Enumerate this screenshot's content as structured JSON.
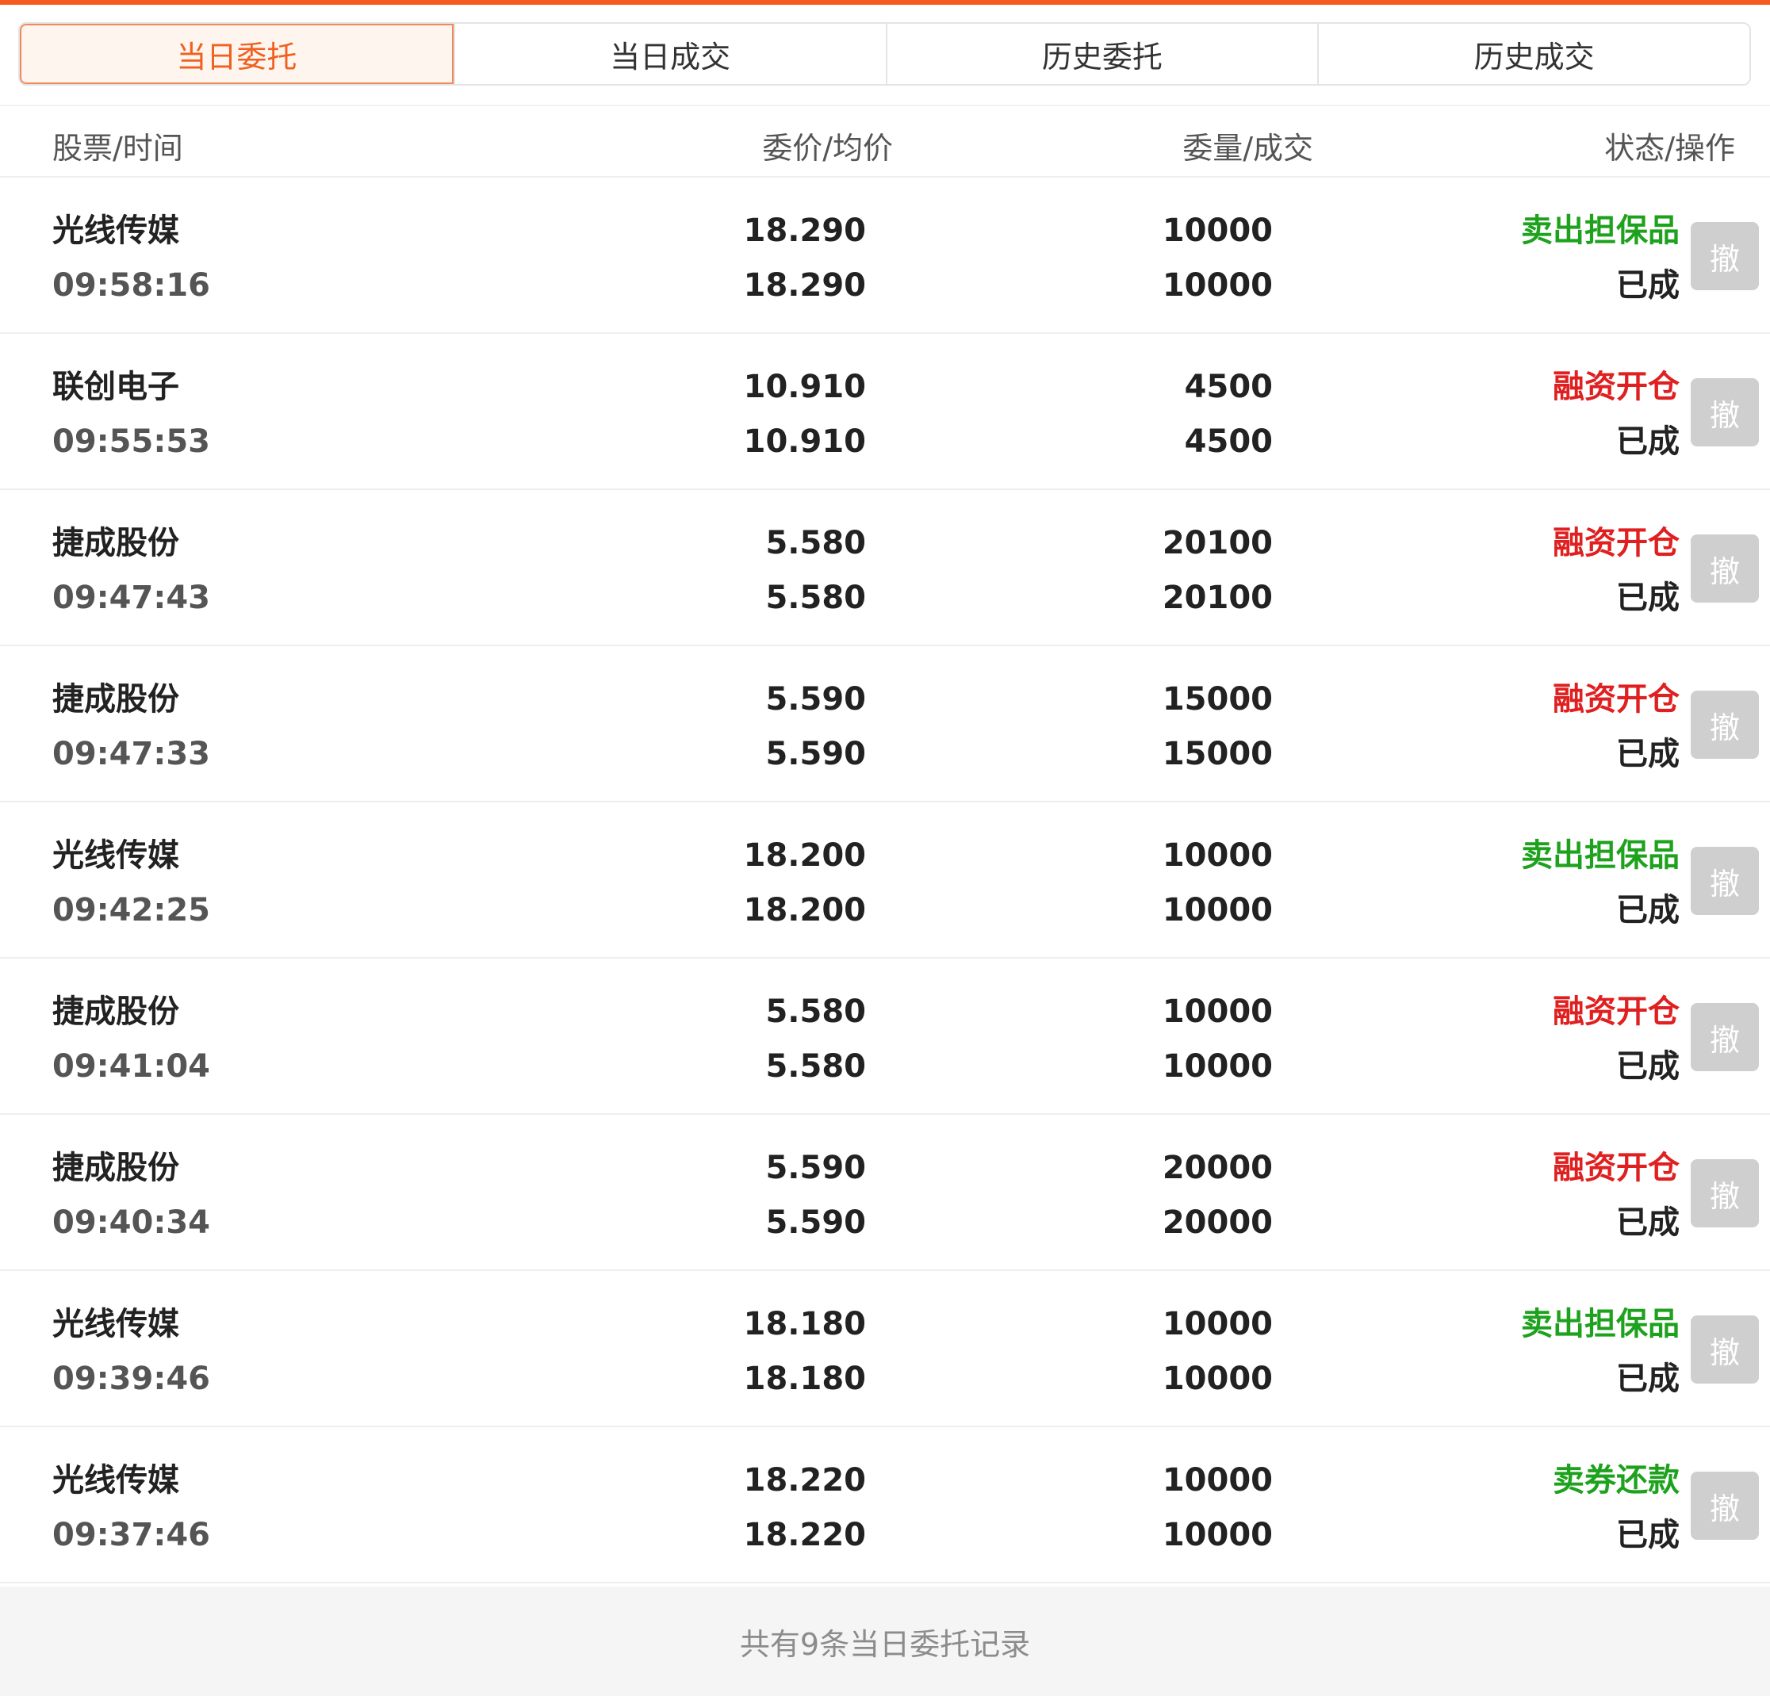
{
  "tabs": [
    {
      "label": "当日委托",
      "active": true
    },
    {
      "label": "当日成交",
      "active": false
    },
    {
      "label": "历史委托",
      "active": false
    },
    {
      "label": "历史成交",
      "active": false
    }
  ],
  "header": {
    "stock_time": "股票/时间",
    "price_avg": "委价/均价",
    "qty_deal": "委量/成交",
    "status_action": "状态/操作"
  },
  "colors": {
    "accent": "#f55a1e",
    "buy_red": "#e02020",
    "sell_green": "#1ea21e"
  },
  "orders": [
    {
      "name": "光线传媒",
      "time": "09:58:16",
      "price": "18.290",
      "avg": "18.290",
      "qty": "10000",
      "deal": "10000",
      "type": "卖出担保品",
      "type_color": "green",
      "status": "已成",
      "cancel": "撤"
    },
    {
      "name": "联创电子",
      "time": "09:55:53",
      "price": "10.910",
      "avg": "10.910",
      "qty": "4500",
      "deal": "4500",
      "type": "融资开仓",
      "type_color": "red",
      "status": "已成",
      "cancel": "撤"
    },
    {
      "name": "捷成股份",
      "time": "09:47:43",
      "price": "5.580",
      "avg": "5.580",
      "qty": "20100",
      "deal": "20100",
      "type": "融资开仓",
      "type_color": "red",
      "status": "已成",
      "cancel": "撤"
    },
    {
      "name": "捷成股份",
      "time": "09:47:33",
      "price": "5.590",
      "avg": "5.590",
      "qty": "15000",
      "deal": "15000",
      "type": "融资开仓",
      "type_color": "red",
      "status": "已成",
      "cancel": "撤"
    },
    {
      "name": "光线传媒",
      "time": "09:42:25",
      "price": "18.200",
      "avg": "18.200",
      "qty": "10000",
      "deal": "10000",
      "type": "卖出担保品",
      "type_color": "green",
      "status": "已成",
      "cancel": "撤"
    },
    {
      "name": "捷成股份",
      "time": "09:41:04",
      "price": "5.580",
      "avg": "5.580",
      "qty": "10000",
      "deal": "10000",
      "type": "融资开仓",
      "type_color": "red",
      "status": "已成",
      "cancel": "撤"
    },
    {
      "name": "捷成股份",
      "time": "09:40:34",
      "price": "5.590",
      "avg": "5.590",
      "qty": "20000",
      "deal": "20000",
      "type": "融资开仓",
      "type_color": "red",
      "status": "已成",
      "cancel": "撤"
    },
    {
      "name": "光线传媒",
      "time": "09:39:46",
      "price": "18.180",
      "avg": "18.180",
      "qty": "10000",
      "deal": "10000",
      "type": "卖出担保品",
      "type_color": "green",
      "status": "已成",
      "cancel": "撤"
    },
    {
      "name": "光线传媒",
      "time": "09:37:46",
      "price": "18.220",
      "avg": "18.220",
      "qty": "10000",
      "deal": "10000",
      "type": "卖券还款",
      "type_color": "green",
      "status": "已成",
      "cancel": "撤"
    }
  ],
  "footer": {
    "summary": "共有9条当日委托记录"
  }
}
